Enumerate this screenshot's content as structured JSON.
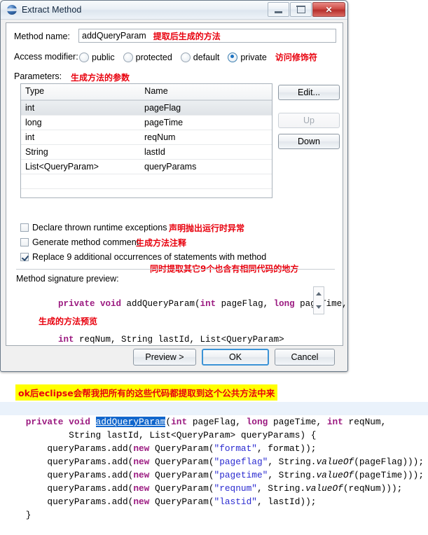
{
  "window": {
    "title": "Extract Method",
    "icon": "java-sphere-icon",
    "controls": {
      "minimize": "minimize",
      "maximize": "maximize",
      "close": "✕"
    }
  },
  "form": {
    "method_name_label": "Method name:",
    "method_name_value": "addQueryParam",
    "method_name_note": "提取后生成的方法",
    "access_modifier_label": "Access modifier:",
    "access_modifier_note": "访问修饰符",
    "access_options": [
      {
        "label": "public",
        "selected": false
      },
      {
        "label": "protected",
        "selected": false
      },
      {
        "label": "default",
        "selected": false
      },
      {
        "label": "private",
        "selected": true
      }
    ],
    "parameters_label": "Parameters:",
    "parameters_note": "生成方法的参数"
  },
  "table": {
    "columns": [
      "Type",
      "Name"
    ],
    "rows": [
      {
        "type": "int",
        "name": "pageFlag",
        "selected": true
      },
      {
        "type": "long",
        "name": "pageTime",
        "selected": false
      },
      {
        "type": "int",
        "name": "reqNum",
        "selected": false
      },
      {
        "type": "String",
        "name": "lastId",
        "selected": false
      },
      {
        "type": "List<QueryParam>",
        "name": "queryParams",
        "selected": false
      },
      {
        "type": "",
        "name": "",
        "selected": false
      },
      {
        "type": "",
        "name": "",
        "selected": false
      }
    ]
  },
  "side_buttons": [
    {
      "label": "Edit...",
      "enabled": true
    },
    {
      "label": "Up",
      "enabled": false
    },
    {
      "label": "Down",
      "enabled": true
    }
  ],
  "checkboxes": [
    {
      "label": "Declare thrown runtime exceptions",
      "checked": false,
      "note": "声明抛出运行时异常"
    },
    {
      "label": "Generate method comment",
      "checked": false,
      "note": "生成方法注释"
    },
    {
      "label": "Replace 9 additional occurrences of statements with method",
      "checked": true,
      "note": "同时提取其它9个也含有相同代码的地方"
    }
  ],
  "preview": {
    "label": "Method signature preview:",
    "note": "生成的方法预览",
    "line1": [
      {
        "t": "private void ",
        "k": true
      },
      {
        "t": "addQueryParam(",
        "k": false
      },
      {
        "t": "int ",
        "k": true
      },
      {
        "t": "pageFlag, ",
        "k": false
      },
      {
        "t": "long ",
        "k": true
      },
      {
        "t": "pageTime,",
        "k": false
      }
    ],
    "line2": [
      {
        "t": "int ",
        "k": true
      },
      {
        "t": "reqNum, String lastId, List<QueryParam>",
        "k": false
      }
    ]
  },
  "footer_buttons": [
    {
      "label": "Preview >",
      "default": false
    },
    {
      "label": "OK",
      "default": true
    },
    {
      "label": "Cancel",
      "default": false
    }
  ],
  "bottom": {
    "note": "ok后eclipse会帮我把所有的这些代码都提取到这个公共方法中来",
    "code_lines": [
      [
        {
          "t": "private void ",
          "c": "kw"
        },
        {
          "t": "addQueryParam",
          "c": "sel"
        },
        {
          "t": "(",
          "c": "p"
        },
        {
          "t": "int ",
          "c": "kw"
        },
        {
          "t": "pageFlag, ",
          "c": "p"
        },
        {
          "t": "long ",
          "c": "kw"
        },
        {
          "t": "pageTime, ",
          "c": "p"
        },
        {
          "t": "int ",
          "c": "kw"
        },
        {
          "t": "reqNum,",
          "c": "p"
        }
      ],
      [
        {
          "t": "        String lastId, List<QueryParam> queryParams) {",
          "c": "p"
        }
      ],
      [
        {
          "t": "    queryParams.add(",
          "c": "p"
        },
        {
          "t": "new ",
          "c": "kw"
        },
        {
          "t": "QueryParam(",
          "c": "p"
        },
        {
          "t": "\"format\"",
          "c": "str"
        },
        {
          "t": ", format));",
          "c": "p"
        }
      ],
      [
        {
          "t": "    queryParams.add(",
          "c": "p"
        },
        {
          "t": "new ",
          "c": "kw"
        },
        {
          "t": "QueryParam(",
          "c": "p"
        },
        {
          "t": "\"pageflag\"",
          "c": "str"
        },
        {
          "t": ", String.",
          "c": "p"
        },
        {
          "t": "valueOf",
          "c": "it"
        },
        {
          "t": "(pageFlag)));",
          "c": "p"
        }
      ],
      [
        {
          "t": "    queryParams.add(",
          "c": "p"
        },
        {
          "t": "new ",
          "c": "kw"
        },
        {
          "t": "QueryParam(",
          "c": "p"
        },
        {
          "t": "\"pagetime\"",
          "c": "str"
        },
        {
          "t": ", String.",
          "c": "p"
        },
        {
          "t": "valueOf",
          "c": "it"
        },
        {
          "t": "(pageTime)));",
          "c": "p"
        }
      ],
      [
        {
          "t": "    queryParams.add(",
          "c": "p"
        },
        {
          "t": "new ",
          "c": "kw"
        },
        {
          "t": "QueryParam(",
          "c": "p"
        },
        {
          "t": "\"reqnum\"",
          "c": "str"
        },
        {
          "t": ", String.",
          "c": "p"
        },
        {
          "t": "valueOf",
          "c": "it"
        },
        {
          "t": "(reqNum)));",
          "c": "p"
        }
      ],
      [
        {
          "t": "    queryParams.add(",
          "c": "p"
        },
        {
          "t": "new ",
          "c": "kw"
        },
        {
          "t": "QueryParam(",
          "c": "p"
        },
        {
          "t": "\"lastid\"",
          "c": "str"
        },
        {
          "t": ", lastId));",
          "c": "p"
        }
      ],
      [
        {
          "t": "}",
          "c": "p"
        }
      ]
    ]
  },
  "colors": {
    "keyword": "#9b1a80",
    "string": "#2a2ad0",
    "annotation_red": "#e8000d",
    "highlight_yellow": "#ffff00",
    "selection_blue": "#1166cc",
    "current_line": "#eaf2fb"
  }
}
